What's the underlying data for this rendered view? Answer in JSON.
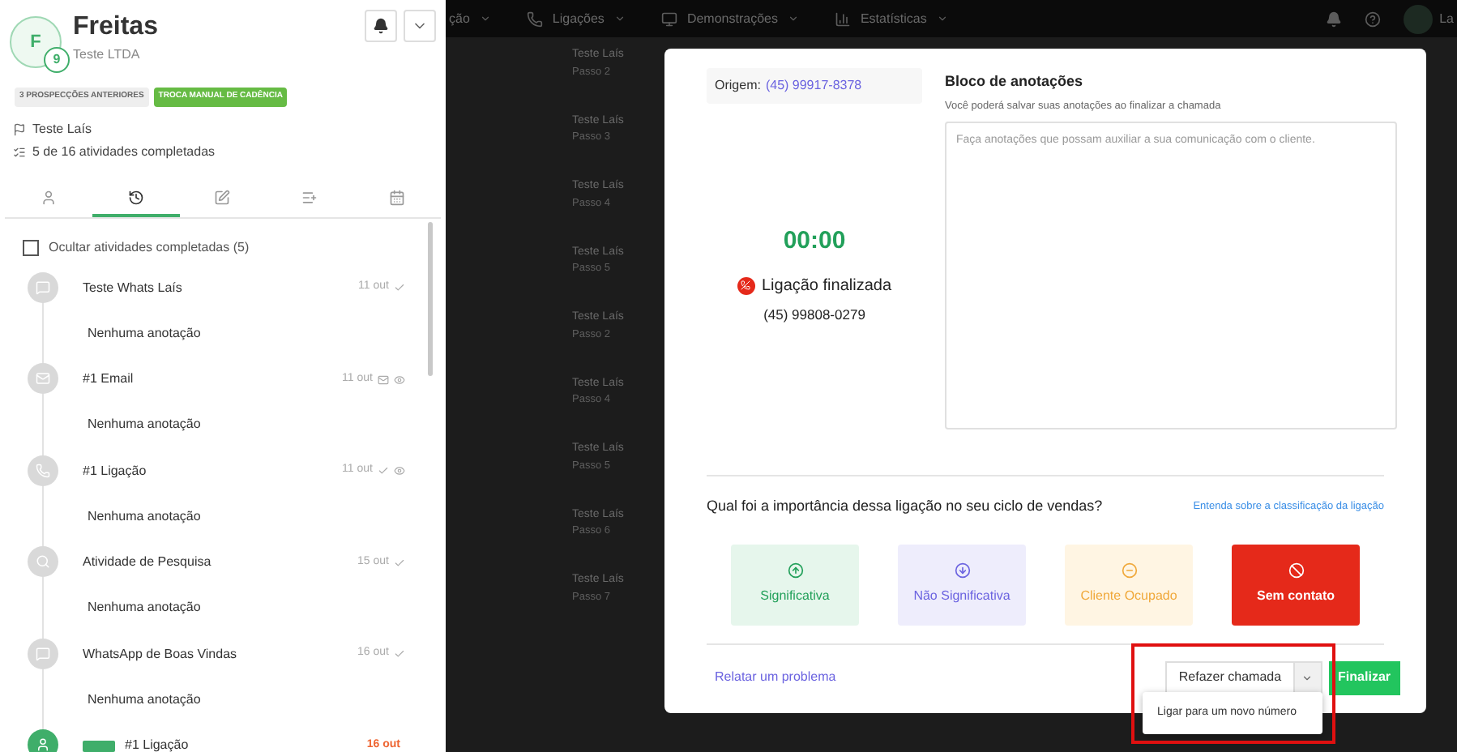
{
  "topnav": {
    "items": [
      {
        "label": "ção",
        "kind": "plain"
      },
      {
        "label": "Ligações",
        "kind": "phone"
      },
      {
        "label": "Demonstrações",
        "kind": "monitor"
      },
      {
        "label": "Estatísticas",
        "kind": "chart"
      }
    ],
    "user": "La"
  },
  "background_rows": [
    {
      "title": "Teste Laís",
      "subtitle": "Passo 2"
    },
    {
      "title": "Teste Laís",
      "subtitle": "Passo 3"
    },
    {
      "title": "Teste Laís",
      "subtitle": "Passo 4"
    },
    {
      "title": "Teste Laís",
      "subtitle": "Passo 5"
    },
    {
      "title": "Teste Laís",
      "subtitle": "Passo 2"
    },
    {
      "title": "Teste Laís",
      "subtitle": "Passo 4"
    },
    {
      "title": "Teste Laís",
      "subtitle": "Passo 5"
    },
    {
      "title": "Teste Laís",
      "subtitle": "Passo 6"
    },
    {
      "title": "Teste Laís",
      "subtitle": "Passo 7"
    }
  ],
  "lead": {
    "initial": "F",
    "count": "9",
    "name": "Freitas",
    "company": "Teste LTDA",
    "tags": [
      {
        "label": "3 PROSPECÇÕES ANTERIORES",
        "kind": "neutral"
      },
      {
        "label": "TROCA MANUAL DE CADÊNCIA",
        "kind": "success"
      }
    ],
    "owner": "Teste Laís",
    "progress": "5 de 16 atividades completadas"
  },
  "tabs": [
    {
      "kind": "person",
      "selected": false
    },
    {
      "kind": "history",
      "selected": true
    },
    {
      "kind": "edit",
      "selected": false
    },
    {
      "kind": "list-add",
      "selected": false
    },
    {
      "kind": "calendar",
      "selected": false
    }
  ],
  "hide_completed": {
    "label": "Ocultar atividades completadas (5)",
    "checked": false
  },
  "activities": [
    {
      "kind": "chat",
      "title": "Teste Whats Laís",
      "date": "11 out",
      "done": true,
      "mail_opened": false,
      "viewed": false,
      "note": "Nenhuma anotação",
      "current": false
    },
    {
      "kind": "email",
      "title": "#1 Email",
      "date": "11 out",
      "done": false,
      "mail_opened": true,
      "viewed": true,
      "note": "Nenhuma anotação",
      "current": false
    },
    {
      "kind": "phone",
      "title": "#1 Ligação",
      "date": "11 out",
      "done": true,
      "mail_opened": false,
      "viewed": true,
      "note": "Nenhuma anotação",
      "current": false
    },
    {
      "kind": "search",
      "title": "Atividade de Pesquisa",
      "date": "15 out",
      "done": true,
      "mail_opened": false,
      "viewed": false,
      "note": "Nenhuma anotação",
      "current": false
    },
    {
      "kind": "chat",
      "title": "WhatsApp de Boas Vindas",
      "date": "16 out",
      "done": true,
      "mail_opened": false,
      "viewed": false,
      "note": "Nenhuma anotação",
      "current": false
    },
    {
      "kind": "person",
      "title": "#1 Ligação",
      "date": "16 out",
      "done": false,
      "mail_opened": false,
      "viewed": false,
      "current": true
    }
  ],
  "call": {
    "origin_label": "Origem:",
    "origin_number": "(45) 99917-8378",
    "timer": "00:00",
    "status": "Ligação finalizada",
    "number": "(45) 99808-0279"
  },
  "notes": {
    "title": "Bloco de anotações",
    "subtitle": "Você poderá salvar suas anotações ao finalizar a chamada",
    "placeholder": "Faça anotações que possam auxiliar a sua comunicação com o cliente."
  },
  "classification": {
    "question": "Qual foi a importância dessa ligação no seu ciclo de vendas?",
    "help_link": "Entenda sobre a classificação da ligação",
    "options": [
      {
        "kind": "significant",
        "label": "Significativa",
        "selected": false
      },
      {
        "kind": "not-significant",
        "label": "Não Significativa",
        "selected": false
      },
      {
        "kind": "busy",
        "label": "Cliente Ocupado",
        "selected": false
      },
      {
        "kind": "no-contact",
        "label": "Sem contato",
        "selected": true
      }
    ]
  },
  "footer": {
    "report_link": "Relatar um problema",
    "redial": "Refazer chamada",
    "menu_open": true,
    "menu_items": [
      "Ligar para um novo número"
    ],
    "finish": "Finalizar"
  }
}
